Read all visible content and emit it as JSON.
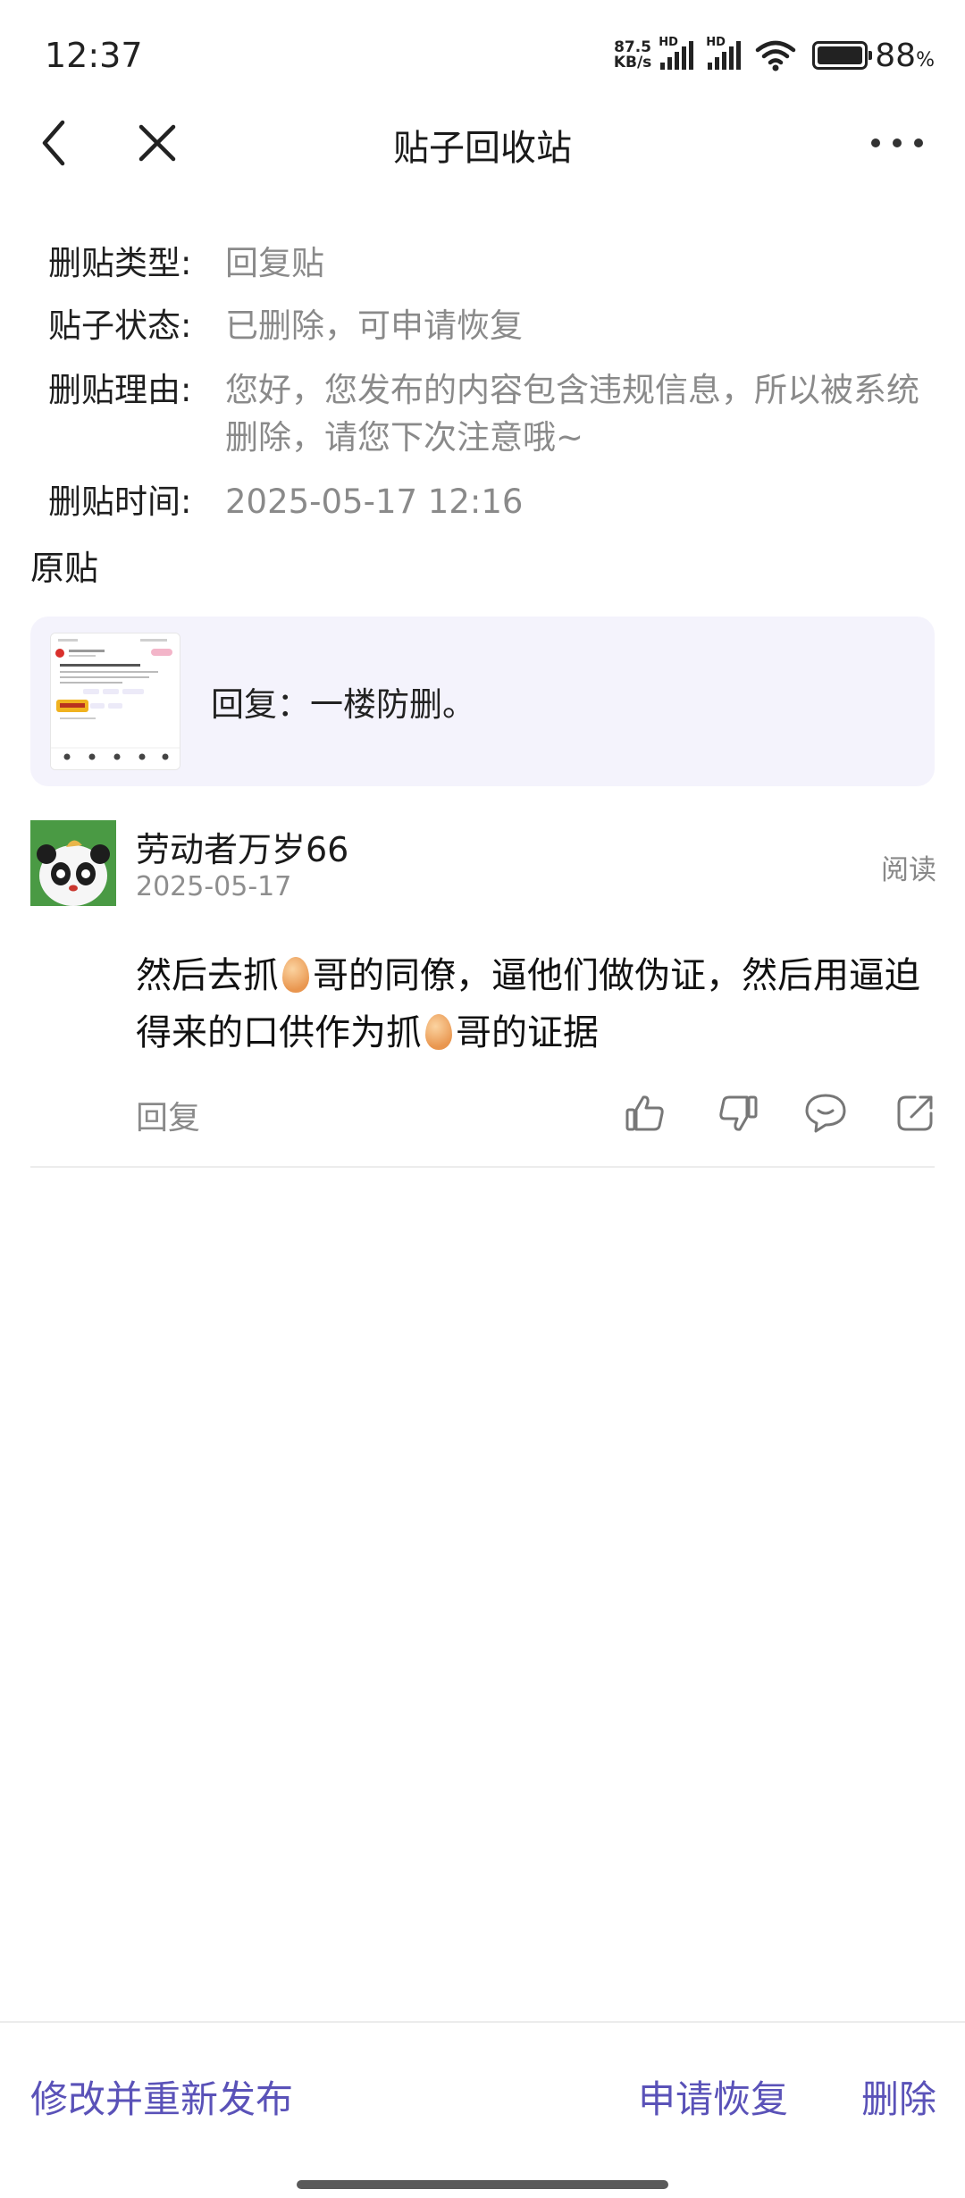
{
  "status_bar": {
    "time": "12:37",
    "net_speed_value": "87.5",
    "net_speed_unit": "KB/s",
    "hd_label": "HD",
    "battery_percent": "88",
    "battery_suffix": "%"
  },
  "nav": {
    "title": "贴子回收站",
    "back_icon": "chevron-left-icon",
    "close_icon": "close-icon",
    "more_icon": "more-horizontal-icon"
  },
  "info": {
    "type_label": "删贴类型:",
    "type_value": "回复贴",
    "status_label": "贴子状态:",
    "status_value": "已删除，可申请恢复",
    "reason_label": "删贴理由:",
    "reason_value": "您好，您发布的内容包含违规信息，所以被系统删除，请您下次注意哦~",
    "time_label": "删贴时间:",
    "time_value": "2025-05-17 12:16"
  },
  "original": {
    "section_title": "原贴",
    "card_text": "回复：一楼防删。"
  },
  "comment": {
    "username": "劳动者万岁66",
    "date": "2025-05-17",
    "read_label": "阅读",
    "text_parts": [
      " 然后去抓",
      "哥的同僚，逼他们做伪证，然后用逼迫得来的口供作为抓",
      "哥的证据"
    ],
    "reply_label": "回复",
    "action_icons": [
      "thumbs-up-icon",
      "thumbs-down-icon",
      "comment-icon",
      "share-icon"
    ]
  },
  "bottom": {
    "edit_repost": "修改并重新发布",
    "apply_restore": "申请恢复",
    "delete": "删除"
  },
  "colors": {
    "accent": "#5a52b8",
    "card_bg": "#f4f3fc",
    "muted_text": "#8a8a8a"
  }
}
